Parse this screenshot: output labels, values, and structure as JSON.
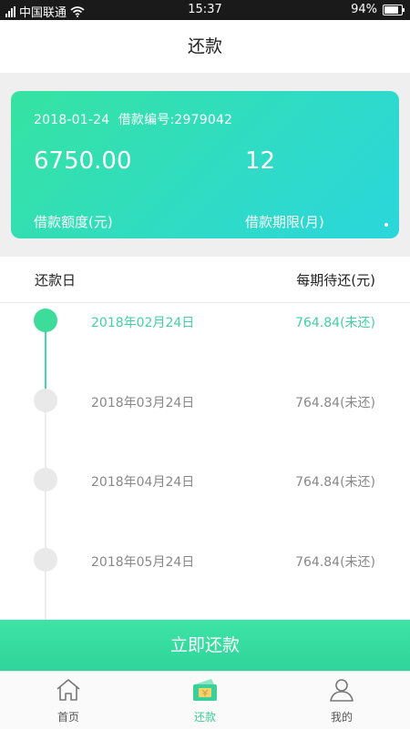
{
  "status_bar": {
    "carrier": "中国联通",
    "time": "15:37",
    "battery": "94%",
    "battery_level": 0.94
  },
  "header": {
    "title": "还款"
  },
  "loan": {
    "date": "2018-01-24",
    "number_label": "借款编号:2979042",
    "amount": "6750.00",
    "term": "12",
    "amount_label": "借款额度(元)",
    "term_label": "借款期限(月)"
  },
  "schedule": {
    "col_date": "还款日",
    "col_amount": "每期待还(元)",
    "items": [
      {
        "date": "2018年02月24日",
        "amount": "764.84(未还)",
        "current": true
      },
      {
        "date": "2018年03月24日",
        "amount": "764.84(未还)",
        "current": false
      },
      {
        "date": "2018年04月24日",
        "amount": "764.84(未还)",
        "current": false
      },
      {
        "date": "2018年05月24日",
        "amount": "764.84(未还)",
        "current": false
      }
    ]
  },
  "pay_button": "立即还款",
  "tabs": [
    {
      "label": "首页",
      "icon": "home-icon",
      "active": false
    },
    {
      "label": "还款",
      "icon": "repay-icon",
      "active": true
    },
    {
      "label": "我的",
      "icon": "profile-icon",
      "active": false
    }
  ],
  "colors": {
    "accent": "#3ddc9a",
    "inactive_node": "#e9e9e9"
  }
}
